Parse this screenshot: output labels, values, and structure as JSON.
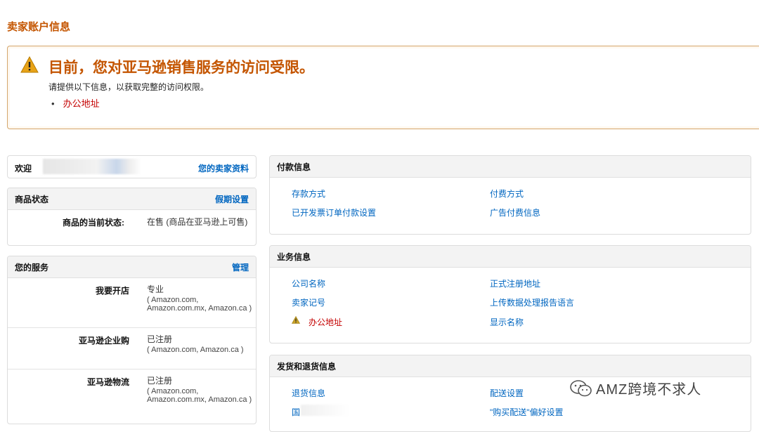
{
  "page": {
    "title": "卖家账户信息"
  },
  "alert": {
    "heading": "目前，您对亚马逊销售服务的访问受限。",
    "text": "请提供以下信息，以获取完整的访问权限。",
    "bullet_mark": "•",
    "item": "办公地址"
  },
  "welcome": {
    "label": "欢迎",
    "link": "您的卖家资料"
  },
  "listing_status": {
    "title": "商品状态",
    "link": "假期设置",
    "key": "商品的当前状态:",
    "value": "在售 (商品在亚马逊上可售)"
  },
  "services": {
    "title": "您的服务",
    "link": "管理",
    "rows": [
      {
        "key": "我要开店",
        "status": "专业",
        "sub": "( Amazon.com, Amazon.com.mx, Amazon.ca )"
      },
      {
        "key": "亚马逊企业购",
        "status": "已注册",
        "sub": "( Amazon.com, Amazon.ca )"
      },
      {
        "key": "亚马逊物流",
        "status": "已注册",
        "sub": "( Amazon.com, Amazon.com.mx, Amazon.ca )"
      }
    ]
  },
  "payment": {
    "title": "付款信息",
    "links": [
      "存款方式",
      "付费方式",
      "已开发票订单付款设置",
      "广告付费信息"
    ]
  },
  "business": {
    "title": "业务信息",
    "links": [
      "公司名称",
      "正式注册地址",
      "卖家记号",
      "上传数据处理报告语言",
      "办公地址",
      "显示名称"
    ]
  },
  "shipping": {
    "title": "发货和退货信息",
    "links": [
      "退货信息",
      "配送设置",
      "国",
      "\"购买配送\"偏好设置"
    ]
  },
  "watermark": {
    "text": "AMZ跨境不求人"
  },
  "colors": {
    "accent": "#c45500",
    "link": "#0066c0",
    "warning": "#c40000",
    "alert_icon": "#e3a21a"
  }
}
